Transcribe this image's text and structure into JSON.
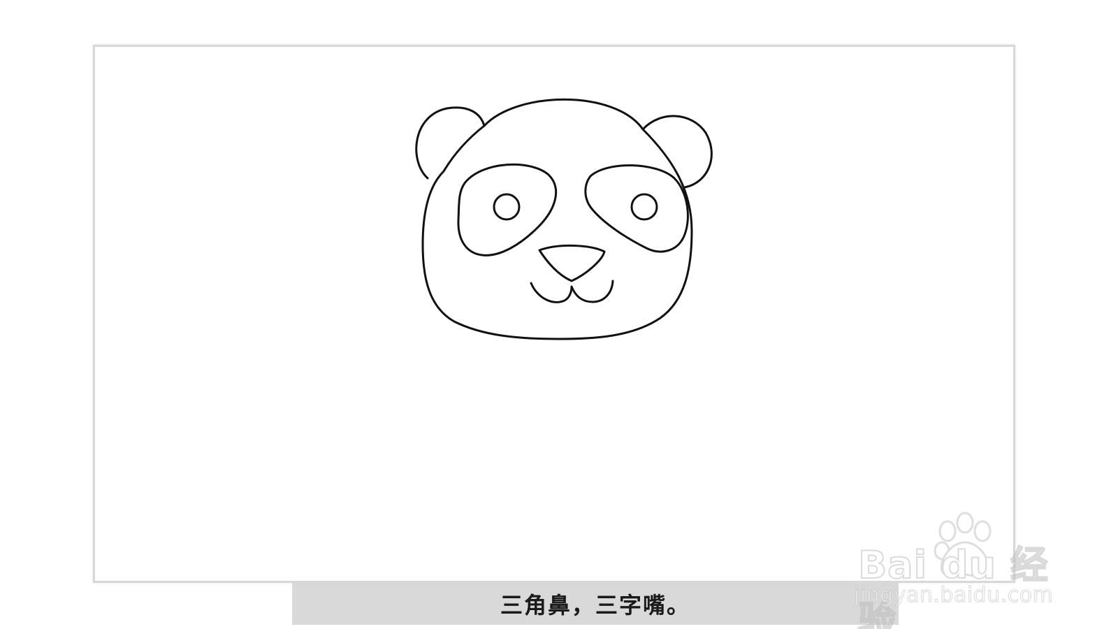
{
  "caption": {
    "text": "三角鼻，三字嘴。",
    "background": "#d9d9d9"
  },
  "watermark": {
    "brand": "Bai du 经验",
    "url": "jingyan.baidu.com",
    "icon": "paw-icon"
  },
  "drawing": {
    "subject": "panda-face-outline",
    "stroke_color": "#111111"
  }
}
